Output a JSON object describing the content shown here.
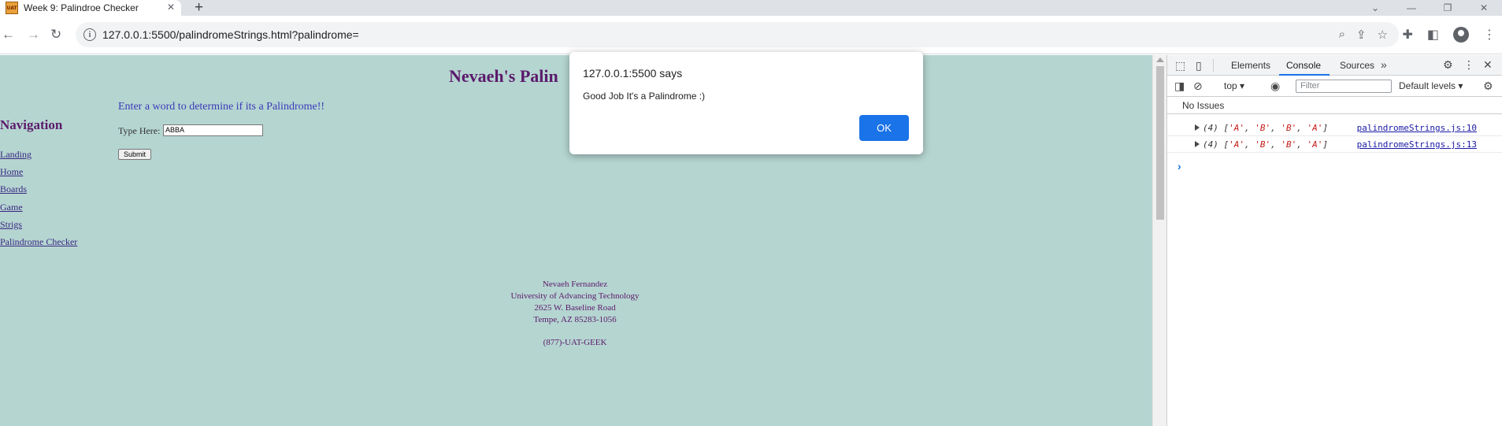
{
  "browser": {
    "tab_title": "Week 9: Palindroe Checker",
    "tab_favicon_text": "UAT",
    "tab_close": "✕",
    "new_tab": "+",
    "url": "127.0.0.1:5500/palindromeStrings.html?palindrome=",
    "window_controls": [
      "⌄",
      "—",
      "❐",
      "✕"
    ]
  },
  "page": {
    "site_title": "Nevaeh's Palin",
    "nav_heading": "Navigation",
    "nav_links": [
      "Landing",
      "Home",
      "Boards",
      "Game",
      "Strigs",
      "Palindrome Checker"
    ],
    "instruction": "Enter a word to determine if its a Palindrome!!",
    "type_label": "Type Here:",
    "input_value": "ABBA",
    "submit_label": "Submit",
    "footer": {
      "name": "Nevaeh Fernandez",
      "school": "University of Advancing Technology",
      "street": "2625 W. Baseline Road",
      "city": "Tempe, AZ 85283-1056",
      "phone": "(877)-UAT-GEEK"
    }
  },
  "dialog": {
    "origin": "127.0.0.1:5500 says",
    "message": "Good Job It's a Palindrome :)",
    "ok_label": "OK"
  },
  "devtools": {
    "tabs": [
      "Elements",
      "Console",
      "Sources"
    ],
    "active_tab": "Console",
    "context": "top",
    "filter_placeholder": "Filter",
    "levels": "Default levels",
    "issues": "No Issues",
    "logs": [
      {
        "count": "(4)",
        "items": [
          "'A'",
          "'B'",
          "'B'",
          "'A'"
        ],
        "source": "palindromeStrings.js:10"
      },
      {
        "count": "(4)",
        "items": [
          "'A'",
          "'B'",
          "'B'",
          "'A'"
        ],
        "source": "palindromeStrings.js:13"
      }
    ],
    "prompt": "›"
  },
  "colors": {
    "page_bg": "#b5d5d1",
    "heading": "#5b1a6b",
    "link": "#3a2880",
    "accent": "#1a73e8"
  }
}
